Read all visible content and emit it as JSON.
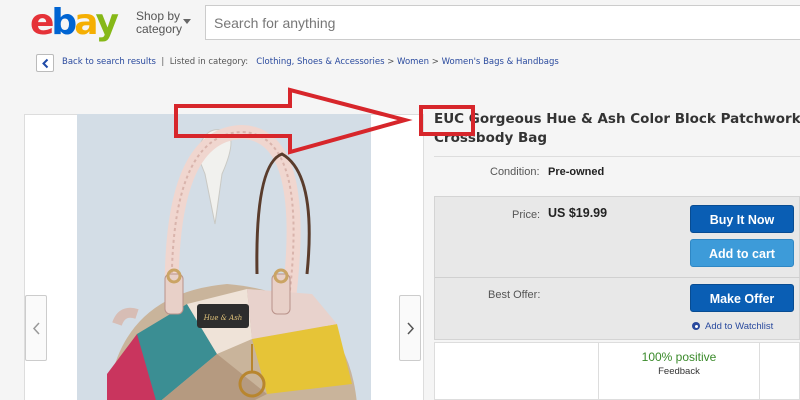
{
  "header": {
    "logo_letters": [
      "e",
      "b",
      "a",
      "y"
    ],
    "logo_colors": [
      "#e53238",
      "#0064d2",
      "#f5af02",
      "#86b817"
    ],
    "shop_by_line1": "Shop by",
    "shop_by_line2": "category",
    "search_placeholder": "Search for anything"
  },
  "breadcrumb": {
    "back_link": "Back to search results",
    "listed_in": "Listed in category:",
    "items": [
      "Clothing, Shoes & Accessories",
      "Women",
      "Women's Bags & Handbags"
    ],
    "separator": ">"
  },
  "listing": {
    "title_line1": "EUC Gorgeous Hue & Ash Color Block Patchwork Dome",
    "title_line2": "Crossbody Bag",
    "condition_label": "Condition:",
    "condition_value": "Pre-owned",
    "price_label": "Price:",
    "price_value": "US $19.99",
    "best_offer_label": "Best Offer:",
    "buy_now_label": "Buy It Now",
    "add_to_cart_label": "Add to cart",
    "make_offer_label": "Make Offer",
    "watchlist_label": "Add to Watchlist",
    "seller_positive": "100% positive",
    "seller_feedback": "Feedback",
    "bag_brand_text": "Hue & Ash"
  },
  "annotation": {
    "color": "#d7262b"
  }
}
